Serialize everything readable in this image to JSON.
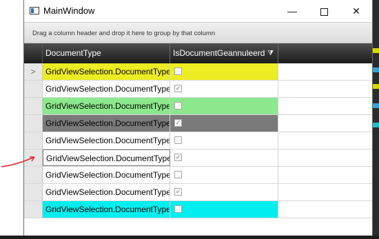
{
  "window": {
    "title": "MainWindow",
    "minimize_glyph": "—",
    "close_glyph": "✕"
  },
  "grid": {
    "group_hint": "Drag a column header and drop it here to group by that column",
    "columns": [
      "DocumentType",
      "IsDocumentGeannuleerd"
    ],
    "filter_glyph": "⧩",
    "current_row_glyph": ">",
    "rows": [
      {
        "document_type": "GridViewSelection.DocumentType",
        "is_document_geannuleerd": false,
        "background": "#eded24"
      },
      {
        "document_type": "GridViewSelection.DocumentType",
        "is_document_geannuleerd": true,
        "background": "#ffffff"
      },
      {
        "document_type": "GridViewSelection.DocumentType",
        "is_document_geannuleerd": false,
        "background": "#8ce88c"
      },
      {
        "document_type": "GridViewSelection.DocumentType",
        "is_document_geannuleerd": true,
        "background": "#7a7a7a"
      },
      {
        "document_type": "GridViewSelection.DocumentType",
        "is_document_geannuleerd": false,
        "background": "#ffffff"
      },
      {
        "document_type": "GridViewSelection.DocumentType",
        "is_document_geannuleerd": true,
        "background": "#ffffff"
      },
      {
        "document_type": "GridViewSelection.DocumentType",
        "is_document_geannuleerd": false,
        "background": "#ffffff"
      },
      {
        "document_type": "GridViewSelection.DocumentType",
        "is_document_geannuleerd": true,
        "background": "#ffffff"
      },
      {
        "document_type": "GridViewSelection.DocumentType",
        "is_document_geannuleerd": false,
        "background": "#00eeee"
      }
    ]
  },
  "colors": {
    "header_dark": "#2a2a2a",
    "annotation_arrow": "#e0242a"
  }
}
